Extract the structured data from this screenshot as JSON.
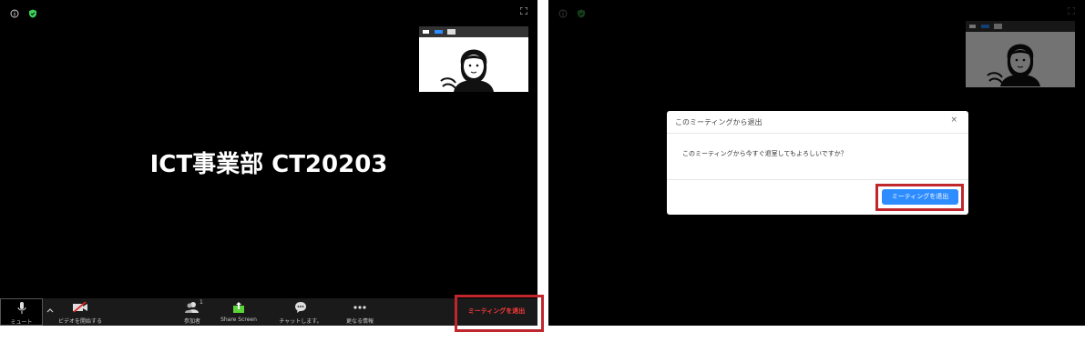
{
  "left_panel": {
    "meeting_name": "ICT事業部 CT20203",
    "toolbar": {
      "mute_label": "ミュート",
      "video_label": "ビデオを開始する",
      "participants_label": "参加者",
      "participants_count": "1",
      "share_label": "Share Screen",
      "chat_label": "チャットします。",
      "more_label": "更なる情報",
      "leave_label": "ミーティングを退出"
    }
  },
  "right_panel": {
    "dialog": {
      "title": "このミーティングから退出",
      "close_symbol": "×",
      "message": "このミーティングから今すぐ退室してもよろしいですか？",
      "confirm_label": "ミーティングを退出"
    }
  },
  "colors": {
    "highlight": "#c0272d",
    "leave_text": "#ff3a3a",
    "confirm_button": "#2d8cff",
    "share_icon": "#5bd43a",
    "shield_icon": "#3ecf5a"
  }
}
